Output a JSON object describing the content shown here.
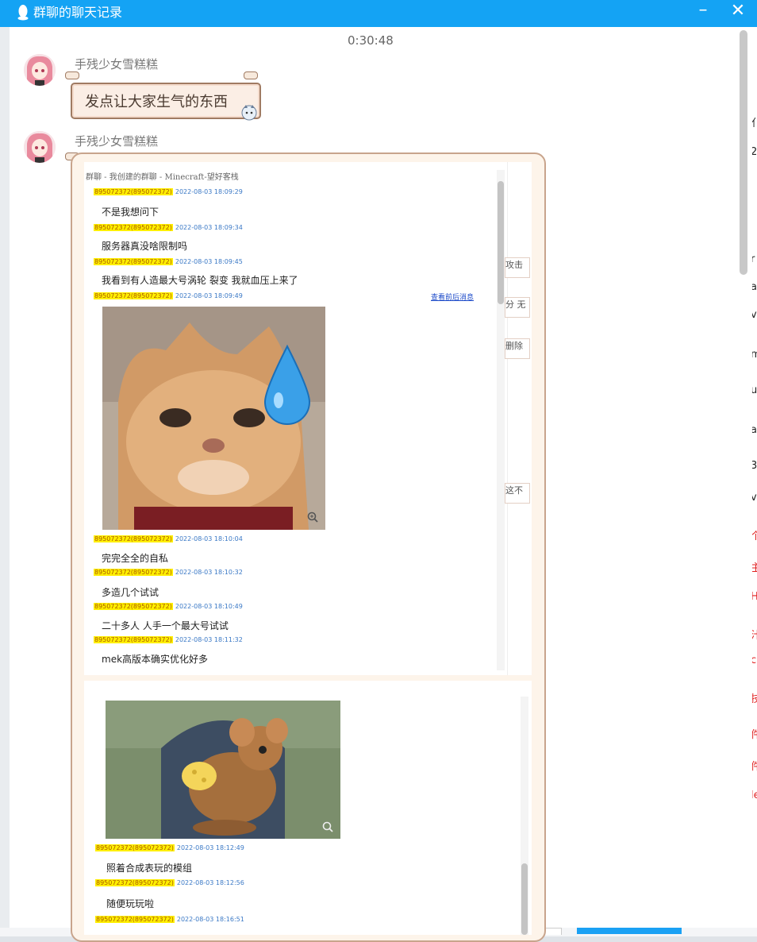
{
  "window": {
    "title": "群聊的聊天记录",
    "minimize_symbol": "–",
    "close_symbol": "✕",
    "logo_icon": "qq-penguin-icon"
  },
  "timestamp": "0:30:48",
  "messages": [
    {
      "sender": "手残少女雪糕糕",
      "text": "发点让大家生气的东西"
    },
    {
      "sender": "手残少女雪糕糕",
      "type": "screenshots"
    }
  ],
  "screenshot1": {
    "header": "群聊 - 我创建的群聊 - Minecraft-望好客栈",
    "view_context_link": "查看前后消息",
    "entries": [
      {
        "sender_id": "895072372(895072372)",
        "time": "2022-08-03 18:09:29",
        "text": "不是我想问下"
      },
      {
        "sender_id": "895072372(895072372)",
        "time": "2022-08-03 18:09:34",
        "text": "服务器真没啥限制吗"
      },
      {
        "sender_id": "895072372(895072372)",
        "time": "2022-08-03 18:09:45",
        "text": "我看到有人造最大号涡轮 裂变 我就血压上来了"
      },
      {
        "sender_id": "895072372(895072372)",
        "time": "2022-08-03 18:09:49",
        "text": ""
      },
      {
        "sender_id": "895072372(895072372)",
        "time": "2022-08-03 18:10:04",
        "text": "完完全全的自私"
      },
      {
        "sender_id": "895072372(895072372)",
        "time": "2022-08-03 18:10:32",
        "text": "多造几个试试"
      },
      {
        "sender_id": "895072372(895072372)",
        "time": "2022-08-03 18:10:49",
        "text": "二十多人 人手一个最大号试试"
      },
      {
        "sender_id": "895072372(895072372)",
        "time": "2022-08-03 18:11:32",
        "text": "mek高版本确实优化好多"
      }
    ],
    "side_fragments": [
      "攻击",
      "分 无",
      "删除",
      "这不"
    ]
  },
  "screenshot2": {
    "entries": [
      {
        "sender_id": "895072372(895072372)",
        "time": "2022-08-03 18:12:49",
        "text": "照着合成表玩的模组"
      },
      {
        "sender_id": "895072372(895072372)",
        "time": "2022-08-03 18:12:56",
        "text": "随便玩玩啦"
      },
      {
        "sender_id": "895072372(895072372)",
        "time": "2022-08-03 18:16:51",
        "text": ""
      }
    ]
  },
  "background_right_glyphs": [
    "亻",
    "2",
    "r",
    "a",
    "v",
    "m",
    "u",
    "a",
    "3",
    "v",
    "个",
    "主",
    "H",
    "汁",
    "c",
    "技",
    "件",
    "件",
    "le"
  ],
  "colors": {
    "titlebar": "#14a3f4",
    "id_highlight": "#ffef00",
    "time_blue": "#3b79c6",
    "bubble_border": "#a07b63"
  }
}
